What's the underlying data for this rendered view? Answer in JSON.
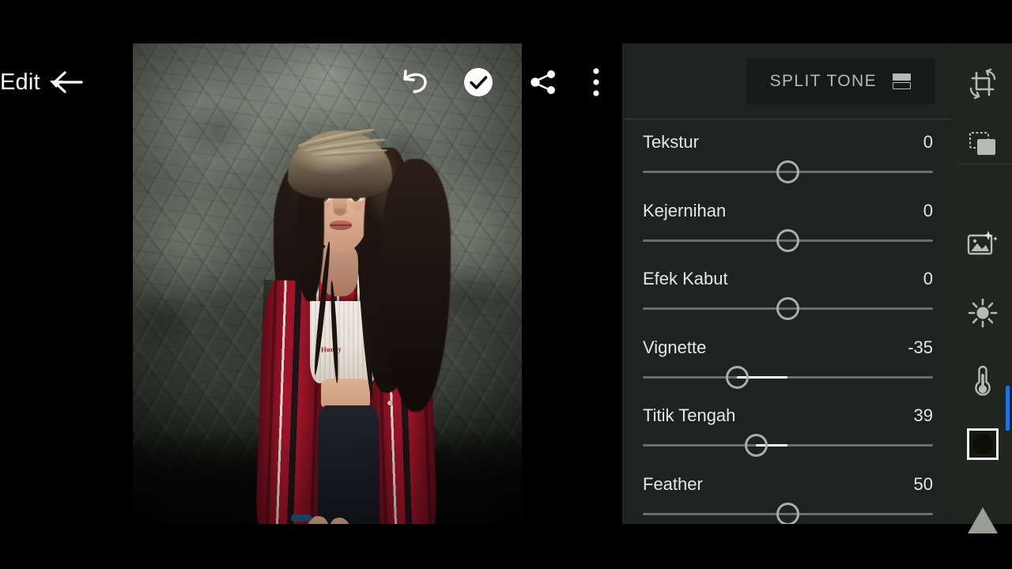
{
  "app": {
    "background_color": "#000000",
    "panel_color": "#1e2220",
    "rail_color": "#21251f",
    "accent_color": "#1a73e8"
  },
  "top_bar": {
    "back_icon": "arrow-left-icon",
    "title": "Edit",
    "dropdown_icon": "caret-down-icon",
    "undo_icon": "undo-icon",
    "accept_icon": "check-circle-icon",
    "share_icon": "share-icon",
    "more_icon": "more-vertical-icon"
  },
  "photo": {
    "alt": "Woman in red plaid flannel shirt and white crop top standing in front of a rock wall",
    "shirt_text": "Honey"
  },
  "panel": {
    "split_tone": {
      "label": "SPLIT TONE",
      "icon": "split-rectangle-icon"
    },
    "sliders": [
      {
        "name": "Tekstur",
        "value": "0",
        "knob_pct": 50.0,
        "fill_from_pct": 50.0,
        "fill_to_pct": 50.0
      },
      {
        "name": "Kejernihan",
        "value": "0",
        "knob_pct": 50.0,
        "fill_from_pct": 50.0,
        "fill_to_pct": 50.0
      },
      {
        "name": "Efek Kabut",
        "value": "0",
        "knob_pct": 50.0,
        "fill_from_pct": 50.0,
        "fill_to_pct": 50.0
      },
      {
        "name": "Vignette",
        "value": "-35",
        "knob_pct": 32.5,
        "fill_from_pct": 32.5,
        "fill_to_pct": 50.0
      },
      {
        "name": "Titik Tengah",
        "value": "39",
        "knob_pct": 39.0,
        "fill_from_pct": 39.0,
        "fill_to_pct": 50.0
      },
      {
        "name": "Feather",
        "value": "50",
        "knob_pct": 50.0,
        "fill_from_pct": 50.0,
        "fill_to_pct": 50.0
      }
    ]
  },
  "tool_rail": {
    "items": [
      {
        "name": "crop-rotate-icon",
        "selected": false
      },
      {
        "name": "presets-copy-icon",
        "selected": false
      },
      {
        "name": "auto-enhance-icon",
        "selected": false
      },
      {
        "name": "light-sun-icon",
        "selected": false
      },
      {
        "name": "color-thermometer-icon",
        "selected": false
      },
      {
        "name": "effects-vignette-icon",
        "selected": true
      },
      {
        "name": "detail-triangle-icon",
        "selected": false
      }
    ],
    "scrollbar": {
      "name": "rail-scrollbar",
      "color": "#1a73e8"
    }
  }
}
